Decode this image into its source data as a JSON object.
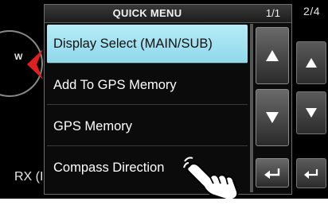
{
  "background": {
    "page_indicator": "2/4",
    "compass_west": "W",
    "rx_label": "RX (I"
  },
  "quick_menu": {
    "title": "QUICK MENU",
    "pager": "1/1",
    "items": [
      {
        "label": "Display Select (MAIN/SUB)",
        "selected": true
      },
      {
        "label": "Add To GPS Memory",
        "selected": false
      },
      {
        "label": "GPS Memory",
        "selected": false
      },
      {
        "label": "Compass Direction",
        "selected": false
      }
    ],
    "buttons": {
      "up_icon": "up-triangle-icon",
      "down_icon": "down-triangle-icon",
      "back_icon": "return-arrow-icon"
    }
  },
  "colors": {
    "selected_item": "#a6e3f1",
    "menu_background": "#0b0b0b",
    "screen_background": "#000000"
  },
  "overlay": {
    "cursor_icon": "pointing-hand-icon"
  }
}
